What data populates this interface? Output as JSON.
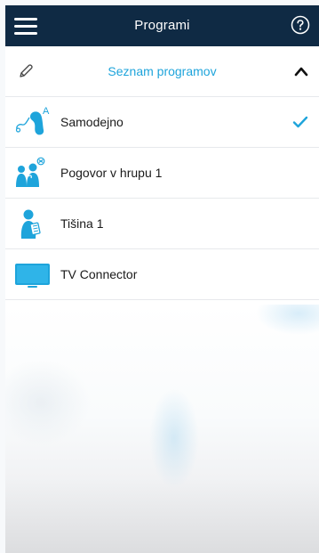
{
  "header": {
    "title": "Programi",
    "menu_icon": "hamburger-menu-icon",
    "help_icon": "question-circle-icon"
  },
  "subheader": {
    "title": "Seznam programov",
    "edit_icon": "pencil-icon",
    "collapse_icon": "chevron-up-icon"
  },
  "programs": [
    {
      "label": "Samodejno",
      "icon": "automatic-hearing-aid-icon",
      "selected": true
    },
    {
      "label": "Pogovor v hrupu 1",
      "icon": "speech-in-noise-icon",
      "selected": false
    },
    {
      "label": "Tišina 1",
      "icon": "quiet-icon",
      "selected": false
    },
    {
      "label": "TV Connector",
      "icon": "tv-icon",
      "selected": false
    }
  ],
  "colors": {
    "header_bg": "#0f2a44",
    "accent": "#1ea4db",
    "icon_blue": "#1ea4db",
    "text": "#1a1a1a"
  }
}
